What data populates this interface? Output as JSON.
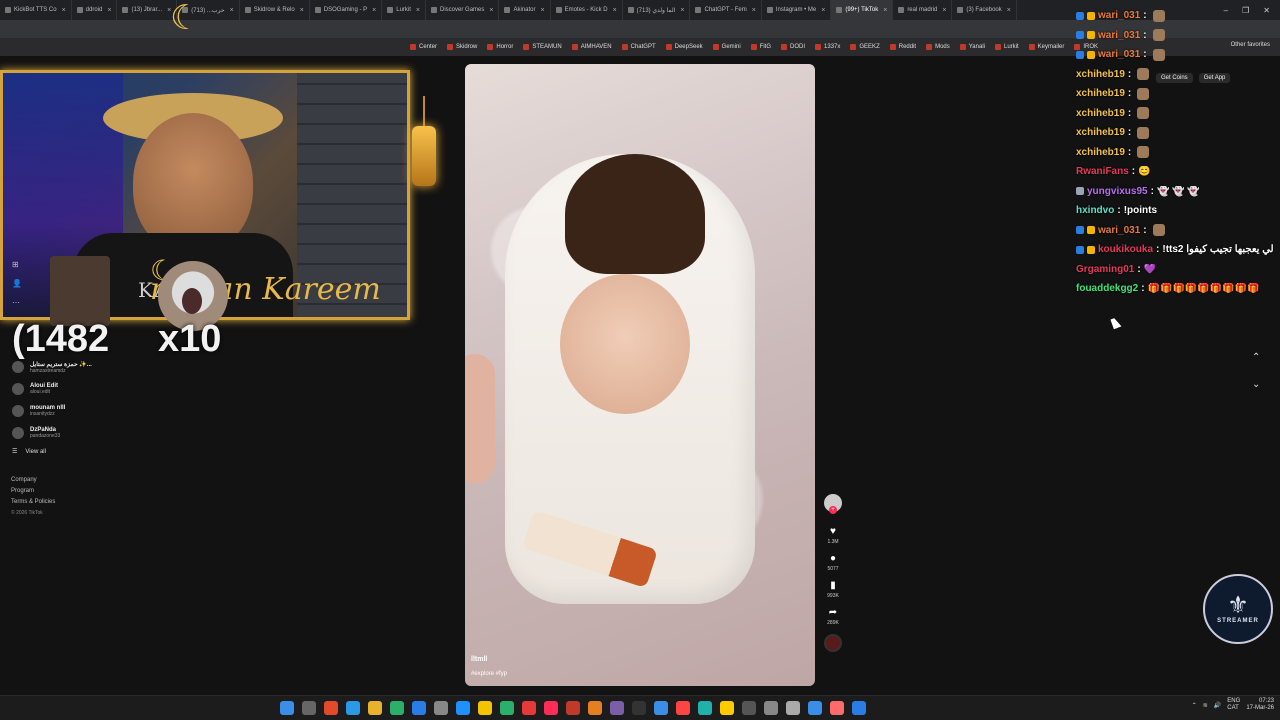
{
  "browser": {
    "tabs": [
      {
        "label": "KickBot TTS Co"
      },
      {
        "label": "ddroid "
      },
      {
        "label": "(13) Jbrar..."
      },
      {
        "label": "حرب... (713)"
      },
      {
        "label": "Skidrow & Relo"
      },
      {
        "label": "DSOGaming - P"
      },
      {
        "label": "Lurkit"
      },
      {
        "label": "Discover Games"
      },
      {
        "label": "Akinator"
      },
      {
        "label": "Emotes - Kick D"
      },
      {
        "label": "(713) الما ولدي"
      },
      {
        "label": "ChatGPT - Fem"
      },
      {
        "label": "Instagram • Me"
      },
      {
        "label": "(99+) TikTok"
      },
      {
        "label": "real madrid"
      },
      {
        "label": "(3) Facebook"
      }
    ],
    "active_tab_index": 13,
    "window_controls": [
      "–",
      "❐",
      "✕"
    ],
    "bookmarks": [
      "Center",
      "Skidrow",
      "Horror",
      "STEAMUN",
      "AIMHAVEN",
      "ChatGPT",
      "DeepSeek",
      "Gemini",
      "FitG",
      "DODI",
      "1337x",
      "GEEKZ",
      "Reddit",
      "Mods",
      "Yanali",
      "Lurkit",
      "Keymailer",
      "IROK"
    ],
    "other_favorites": "Other favorites"
  },
  "overlay": {
    "shirt_text": "KARL",
    "ramadan_text": "madan Kareem",
    "counter": "1482",
    "multiplier": "x10"
  },
  "sidebar": {
    "following": [
      {
        "name": "حمزة ستريم ستايل ✨...",
        "handle": "hamzastreamdz"
      },
      {
        "name": "Aloui Edit",
        "handle": "aloui.edit"
      },
      {
        "name": "mounam nlll",
        "handle": "insanitydzz"
      },
      {
        "name": "DzPaNda",
        "handle": "pandazone33"
      }
    ],
    "view_all": "View all",
    "footer": [
      "Company",
      "Program",
      "Terms & Policies"
    ],
    "copyright": "© 2026 TikTok"
  },
  "video": {
    "username": "lltmll",
    "tags": "#explore #fyp",
    "likes": "1.3M",
    "comments": "5077",
    "saves": "993K",
    "shares": "289K"
  },
  "chat": [
    {
      "user": "wari_031",
      "color": "#e8793b",
      "badges": [
        "#2a7de1",
        "#f5b400"
      ],
      "msg": "",
      "emote": true
    },
    {
      "user": "wari_031",
      "color": "#e8793b",
      "badges": [
        "#2a7de1",
        "#f5b400"
      ],
      "msg": "",
      "emote": true
    },
    {
      "user": "wari_031",
      "color": "#e8793b",
      "badges": [
        "#2a7de1",
        "#f5b400"
      ],
      "msg": "",
      "emote": true
    },
    {
      "user": "xchiheb19",
      "color": "#f2c14e",
      "badges": [],
      "msg": "",
      "emote": true
    },
    {
      "user": "xchiheb19",
      "color": "#f2c14e",
      "badges": [],
      "msg": "",
      "emote": true
    },
    {
      "user": "xchiheb19",
      "color": "#f2c14e",
      "badges": [],
      "msg": "",
      "emote": true
    },
    {
      "user": "xchiheb19",
      "color": "#f2c14e",
      "badges": [],
      "msg": "",
      "emote": true
    },
    {
      "user": "xchiheb19",
      "color": "#f2c14e",
      "badges": [],
      "msg": "",
      "emote": true
    },
    {
      "user": "RwaniFans",
      "color": "#e23a5b",
      "badges": [],
      "msg": "😊",
      "emote": false
    },
    {
      "user": "yungvixus95",
      "color": "#b86ef0",
      "badges": [
        "#9aa4b2"
      ],
      "msg": "👻 👻 👻",
      "emote": false
    },
    {
      "user": "hxindvo",
      "color": "#5ee0c6",
      "badges": [],
      "msg": "!points",
      "emote": false
    },
    {
      "user": "wari_031",
      "color": "#e8793b",
      "badges": [
        "#2a7de1",
        "#f5b400"
      ],
      "msg": "",
      "emote": true
    },
    {
      "user": "koukikouka",
      "color": "#e23a5b",
      "badges": [
        "#2a7de1",
        "#f5b400"
      ],
      "msg": "!tts2 لي يعجبها تجيب كيفوا",
      "emote": false
    },
    {
      "user": "Grgaming01",
      "color": "#e23a5b",
      "badges": [],
      "msg": "💜",
      "emote": false
    },
    {
      "user": "fouaddekgg2",
      "color": "#3ee07a",
      "badges": [],
      "msg": "🎁🎁🎁🎁🎁🎁🎁🎁🎁",
      "emote": false
    }
  ],
  "page_buttons": {
    "get_coins": "Get Coins",
    "get_app": "Get App"
  },
  "logo_text": "STREAMER",
  "taskbar": {
    "icon_colors": [
      "#3a8ee6",
      "#666",
      "#e24a2a",
      "#2a9ae6",
      "#e6b32a",
      "#2ab06a",
      "#2a7de6",
      "#888",
      "#1e90ff",
      "#f5c400",
      "#2ab06a",
      "#e63a3a",
      "#ff2c55",
      "#c0392b",
      "#e67e22",
      "#7b5ea7",
      "#333",
      "#3a8ee6",
      "#ff4444",
      "#20b2aa",
      "#ffcc00",
      "#555",
      "#888",
      "#aaa",
      "#3a8ee6",
      "#ff6b6b",
      "#2a7de6"
    ],
    "lang": "ENG",
    "region": "CAT",
    "time": "07:23",
    "date": "17-Mar-26"
  }
}
